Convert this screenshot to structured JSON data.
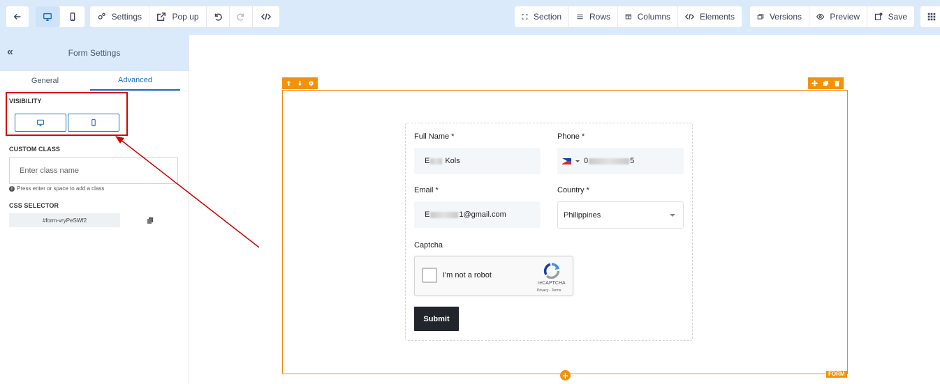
{
  "toolbar": {
    "settings_label": "Settings",
    "popup_label": "Pop up",
    "section_label": "Section",
    "rows_label": "Rows",
    "columns_label": "Columns",
    "elements_label": "Elements",
    "versions_label": "Versions",
    "preview_label": "Preview",
    "save_label": "Save"
  },
  "panel": {
    "collapse_glyph": "«",
    "title": "Form Settings",
    "tabs": [
      {
        "label": "General",
        "active": false
      },
      {
        "label": "Advanced",
        "active": true
      }
    ],
    "visibility_label": "VISIBILITY",
    "custom_class_label": "CUSTOM CLASS",
    "custom_class_placeholder": "Enter class name",
    "custom_class_hint": "Press enter or space to add a class",
    "hint_icon_glyph": "i",
    "css_selector_label": "CSS SELECTOR",
    "css_selector_value": "#form-vryPeSWf2"
  },
  "form": {
    "full_name_label": "Full Name *",
    "full_name_prefix": "E",
    "full_name_suffix": "Kols",
    "phone_label": "Phone *",
    "phone_prefix": "0",
    "phone_suffix": "5",
    "email_label": "Email *",
    "email_prefix": "E",
    "email_suffix": "1@gmail.com",
    "country_label": "Country *",
    "country_value": "Philippines",
    "captcha_label": "Captcha",
    "captcha_text": "I'm not a robot",
    "captcha_brand": "reCAPTCHA",
    "captcha_links": "Privacy - Terms",
    "submit_label": "Submit",
    "badge_label": "FORM",
    "add_glyph": "+"
  },
  "colors": {
    "accent": "#1a6fc4",
    "frame": "#f39209",
    "annotation": "#d60000",
    "topbar": "#dbeafb",
    "submit": "#22262c"
  }
}
